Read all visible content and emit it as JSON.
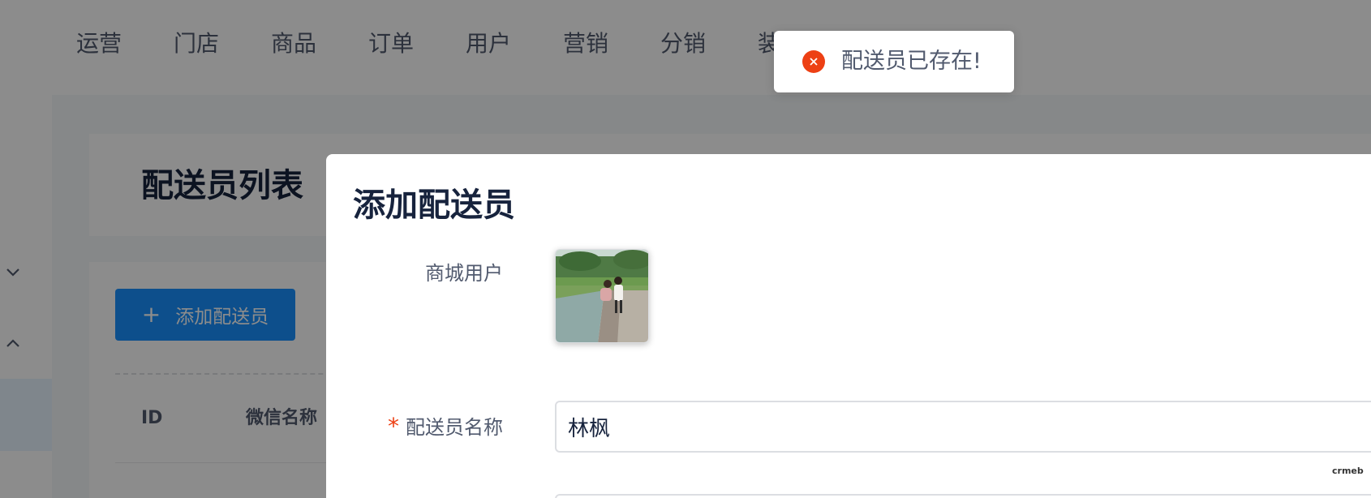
{
  "topnav": {
    "items": [
      "运营",
      "门店",
      "商品",
      "订单",
      "用户",
      "营销",
      "分销",
      "装"
    ]
  },
  "sidebar": {
    "icons": [
      "chevron-down-icon",
      "chevron-up-icon"
    ]
  },
  "page": {
    "title": "配送员列表",
    "add_button_label": "添加配送员",
    "table_headers": [
      "ID",
      "微信名称"
    ]
  },
  "modal": {
    "title": "添加配送员",
    "user_label": "商城用户",
    "name_label": "配送员名称",
    "name_value": "林枫"
  },
  "toast": {
    "message": "配送员已存在!",
    "icon": "error-icon"
  },
  "watermark": "crmeb",
  "colors": {
    "primary": "#1890ff",
    "error": "#ed4014",
    "title": "#17233d",
    "text": "#515a6e"
  }
}
